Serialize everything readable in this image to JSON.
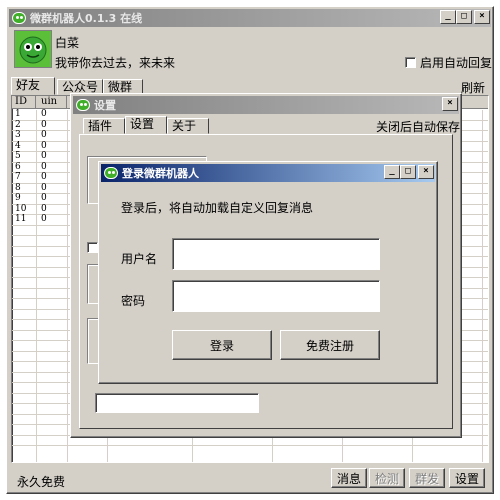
{
  "main_window": {
    "title": "微群机器人0.1.3   在线",
    "nickname": "白菜",
    "signature": "我带你去过去，来未来",
    "auto_reply_label": "启用自动回复",
    "tabs": [
      "好友",
      "公众号",
      "微群"
    ],
    "refresh_label": "刷新",
    "columns": [
      "ID",
      "uin"
    ],
    "rows": [
      {
        "id": "1",
        "uin": "0"
      },
      {
        "id": "2",
        "uin": "0"
      },
      {
        "id": "3",
        "uin": "0"
      },
      {
        "id": "4",
        "uin": "0"
      },
      {
        "id": "5",
        "uin": "0"
      },
      {
        "id": "6",
        "uin": "0"
      },
      {
        "id": "7",
        "uin": "0"
      },
      {
        "id": "8",
        "uin": "0"
      },
      {
        "id": "9",
        "uin": "0"
      },
      {
        "id": "10",
        "uin": "0"
      },
      {
        "id": "11",
        "uin": "0"
      }
    ],
    "status_text": "永久免费",
    "bottom_buttons": [
      "消息",
      "检测",
      "群发",
      "设置"
    ]
  },
  "settings_window": {
    "title": "设置",
    "tabs": [
      "插件",
      "设置",
      "关于"
    ],
    "autosave_label": "关闭后自动保存"
  },
  "login_dialog": {
    "title": "登录微群机器人",
    "info_text": "登录后，将自动加载自定义回复消息",
    "username_label": "用户名",
    "username_value": "",
    "password_label": "密码",
    "password_value": "",
    "login_button": "登录",
    "register_button": "免费注册"
  },
  "colors": {
    "active_title": "#0a246a",
    "inactive_title": "#808080",
    "face": "#d4d0c8",
    "avatar_green": "#3fae29"
  }
}
